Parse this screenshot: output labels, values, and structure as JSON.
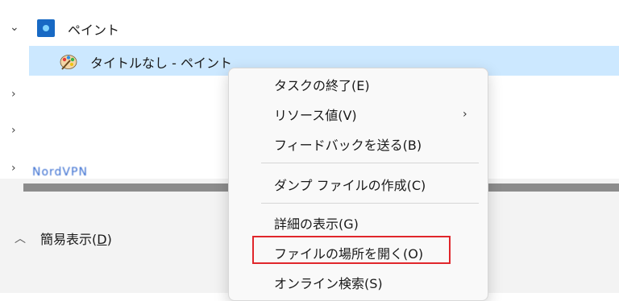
{
  "tree": {
    "group": {
      "label": "ペイント",
      "chevron": "chevron-down-icon",
      "icon": "paint-app-icon"
    },
    "selected_item": {
      "label": "タイトルなし - ペイント",
      "icon": "paint-palette-icon"
    },
    "collapsed_rows": [
      {
        "chevron": "chevron-right-icon"
      },
      {
        "chevron": "chevron-right-icon"
      },
      {
        "chevron": "chevron-right-icon",
        "label": "NordVPN"
      }
    ]
  },
  "footer": {
    "label_main": "簡易表示(",
    "label_key": "D",
    "label_end": ")",
    "caret": "chevron-up-icon"
  },
  "context_menu": {
    "items": [
      {
        "label": "タスクの終了(E)"
      },
      {
        "label": "リソース値(V)",
        "submenu_arrow": "›"
      },
      {
        "label": "フィードバックを送る(B)"
      },
      {
        "label": "ダンプ ファイルの作成(C)"
      },
      {
        "label": "詳細の表示(G)"
      },
      {
        "label": "ファイルの場所を開く(O)"
      },
      {
        "label": "オンライン検索(S)"
      }
    ]
  },
  "colors": {
    "selection": "#cce8ff",
    "highlight_border": "#e0262b",
    "footer_bg": "#f3f3f3"
  }
}
